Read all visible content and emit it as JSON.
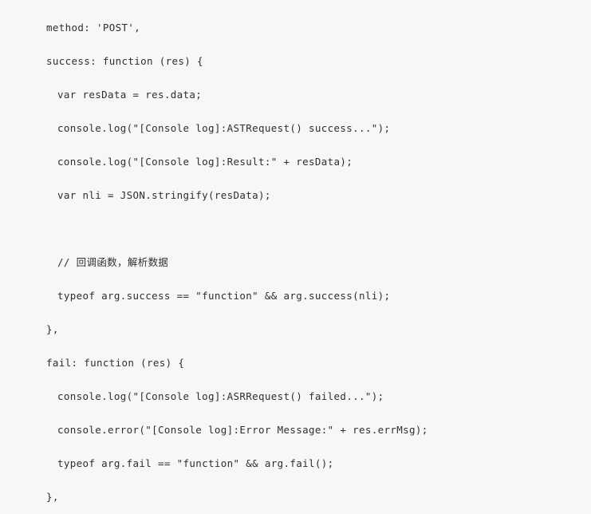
{
  "editor": {
    "background_color": "#f7f7f7",
    "text_color": "#2f2f2f",
    "language": "javascript"
  },
  "code": {
    "lines": [
      {
        "text": "method: 'POST',",
        "indent": 0
      },
      {
        "text": "success: function (res) {",
        "indent": 0
      },
      {
        "text": "var resData = res.data;",
        "indent": 1
      },
      {
        "text": "console.log(\"[Console log]:ASTRequest() success...\");",
        "indent": 1
      },
      {
        "text": "console.log(\"[Console log]:Result:\" + resData);",
        "indent": 1
      },
      {
        "text": "var nli = JSON.stringify(resData);",
        "indent": 1
      },
      {
        "text": "",
        "indent": 0
      },
      {
        "text": "// 回调函数，解析数据",
        "indent": 1
      },
      {
        "text": "typeof arg.success == \"function\" && arg.success(nli);",
        "indent": 1
      },
      {
        "text": "},",
        "indent": 0
      },
      {
        "text": "fail: function (res) {",
        "indent": 0
      },
      {
        "text": "console.log(\"[Console log]:ASRRequest() failed...\");",
        "indent": 1
      },
      {
        "text": "console.error(\"[Console log]:Error Message:\" + res.errMsg);",
        "indent": 1
      },
      {
        "text": "typeof arg.fail == \"function\" && arg.fail();",
        "indent": 1
      },
      {
        "text": "},",
        "indent": 0
      }
    ]
  }
}
